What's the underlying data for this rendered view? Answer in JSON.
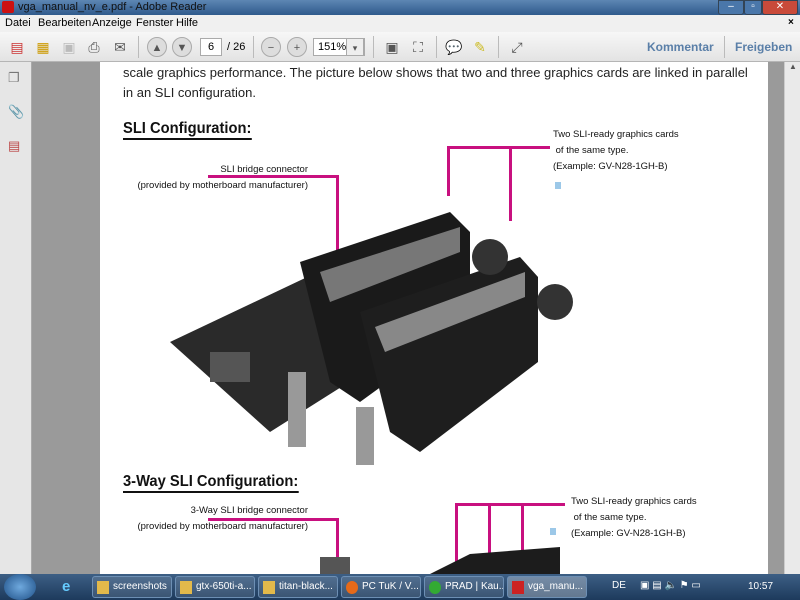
{
  "window": {
    "title": "vga_manual_nv_e.pdf - Adobe Reader"
  },
  "menu": [
    "Datei",
    "Bearbeiten",
    "Anzeige",
    "Fenster",
    "Hilfe"
  ],
  "toolbar": {
    "page_current": "6",
    "page_total": "/ 26",
    "zoom": "151%",
    "comment": "Kommentar",
    "share": "Freigeben"
  },
  "document": {
    "line1": "scale graphics performance. The picture below shows that two and three graphics cards are linked in parallel",
    "line2": "in an SLI configuration.",
    "sli_heading": "SLI Configuration:",
    "bridge1": "SLI bridge connector",
    "bridge2": "(provided by motherboard manufacturer)",
    "cards1": "Two SLI-ready graphics cards",
    "cards2": "of the same type.",
    "cards3": "(Example: GV-N28-1GH-B)",
    "three_heading": "3-Way SLI Configuration:",
    "bridge3_1": "3-Way SLI bridge connector",
    "bridge3_2": "(provided by motherboard manufacturer)",
    "cards3_1": "Two SLI-ready graphics cards",
    "cards3_2": "of the same type.",
    "cards3_3": "(Example: GV-N28-1GH-B)"
  },
  "taskbar": {
    "items": [
      "screenshots",
      "gtx-650ti-a...",
      "titan-black...",
      "PC TuK / V...",
      "PRAD | Kau...",
      "vga_manu..."
    ],
    "lang": "DE",
    "clock": "10:57"
  }
}
